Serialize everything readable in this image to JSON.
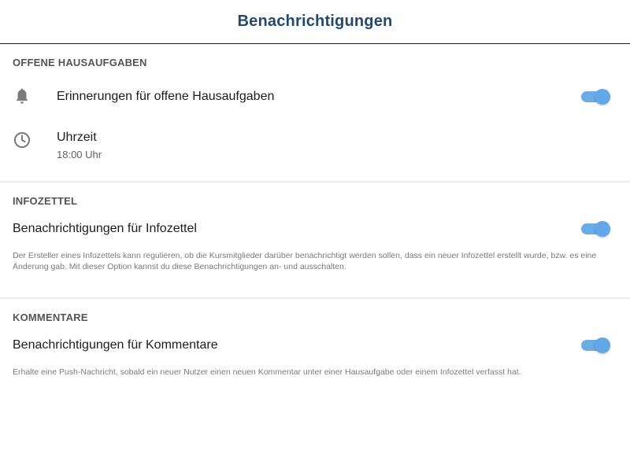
{
  "header": {
    "title": "Benachrichtigungen"
  },
  "sections": [
    {
      "title": "OFFENE HAUSAUFGABEN",
      "items": [
        {
          "icon": "bell-icon",
          "label": "Erinnerungen für offene Hausaufgaben",
          "toggle_on": true
        },
        {
          "icon": "clock-icon",
          "label": "Uhrzeit",
          "value": "18:00 Uhr"
        }
      ]
    },
    {
      "title": "INFOZETTEL",
      "items": [
        {
          "label": "Benachrichtigungen für Infozettel",
          "toggle_on": true
        }
      ],
      "description": "Der Ersteller eines Infozettels kann regulieren, ob die Kursmitglieder darüber benachrichtigt werden sollen, dass ein neuer Infozettel erstellt wurde, bzw. es eine Änderung gab. Mit dieser Option kannst du diese Benachrichtigungen an- und ausschalten."
    },
    {
      "title": "KOMMENTARE",
      "items": [
        {
          "label": "Benachrichtigungen für Kommentare",
          "toggle_on": true
        }
      ],
      "description": "Erhalte eine Push-Nachricht, sobald ein neuer Nutzer einen neuen Kommentar unter einer Hausaufgabe oder einem Infozettel verfasst hat."
    }
  ],
  "colors": {
    "title": "#24496b",
    "toggle_track": "#6aade6",
    "toggle_knob": "#62a8e8",
    "section_header": "#545454",
    "description": "#7b7b7b"
  }
}
